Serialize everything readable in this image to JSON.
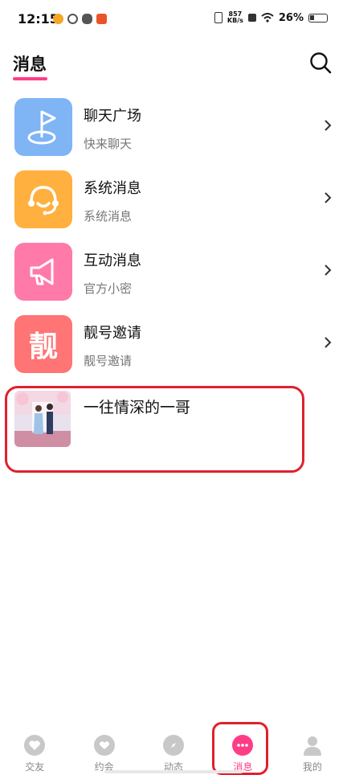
{
  "status_bar": {
    "time": "12:15",
    "net_speed_value": "857",
    "net_speed_unit": "KB/s",
    "battery_percent": "26%"
  },
  "header": {
    "title": "消息"
  },
  "messages": [
    {
      "title": "聊天广场",
      "subtitle": "快来聊天",
      "icon": "flag-icon",
      "color": "#7fb4f5"
    },
    {
      "title": "系统消息",
      "subtitle": "系统消息",
      "icon": "headset-icon",
      "color": "#ffb03f"
    },
    {
      "title": "互动消息",
      "subtitle": "官方小密",
      "icon": "megaphone-icon",
      "color": "#ff7aa8"
    },
    {
      "title": "靓号邀请",
      "subtitle": "靓号邀请",
      "icon": "liang-icon",
      "icon_text": "靓",
      "color": "#ff7474"
    }
  ],
  "conversation": {
    "name": "一往情深的一哥"
  },
  "bottom_nav": [
    {
      "label": "交友",
      "icon": "hearts-icon",
      "active": false
    },
    {
      "label": "约会",
      "icon": "heart-bubble-icon",
      "active": false
    },
    {
      "label": "动态",
      "icon": "compass-icon",
      "active": false
    },
    {
      "label": "消息",
      "icon": "chat-icon",
      "active": true
    },
    {
      "label": "我的",
      "icon": "person-icon",
      "active": false
    }
  ],
  "colors": {
    "accent": "#ff3d86",
    "highlight_box": "#e0202e"
  }
}
